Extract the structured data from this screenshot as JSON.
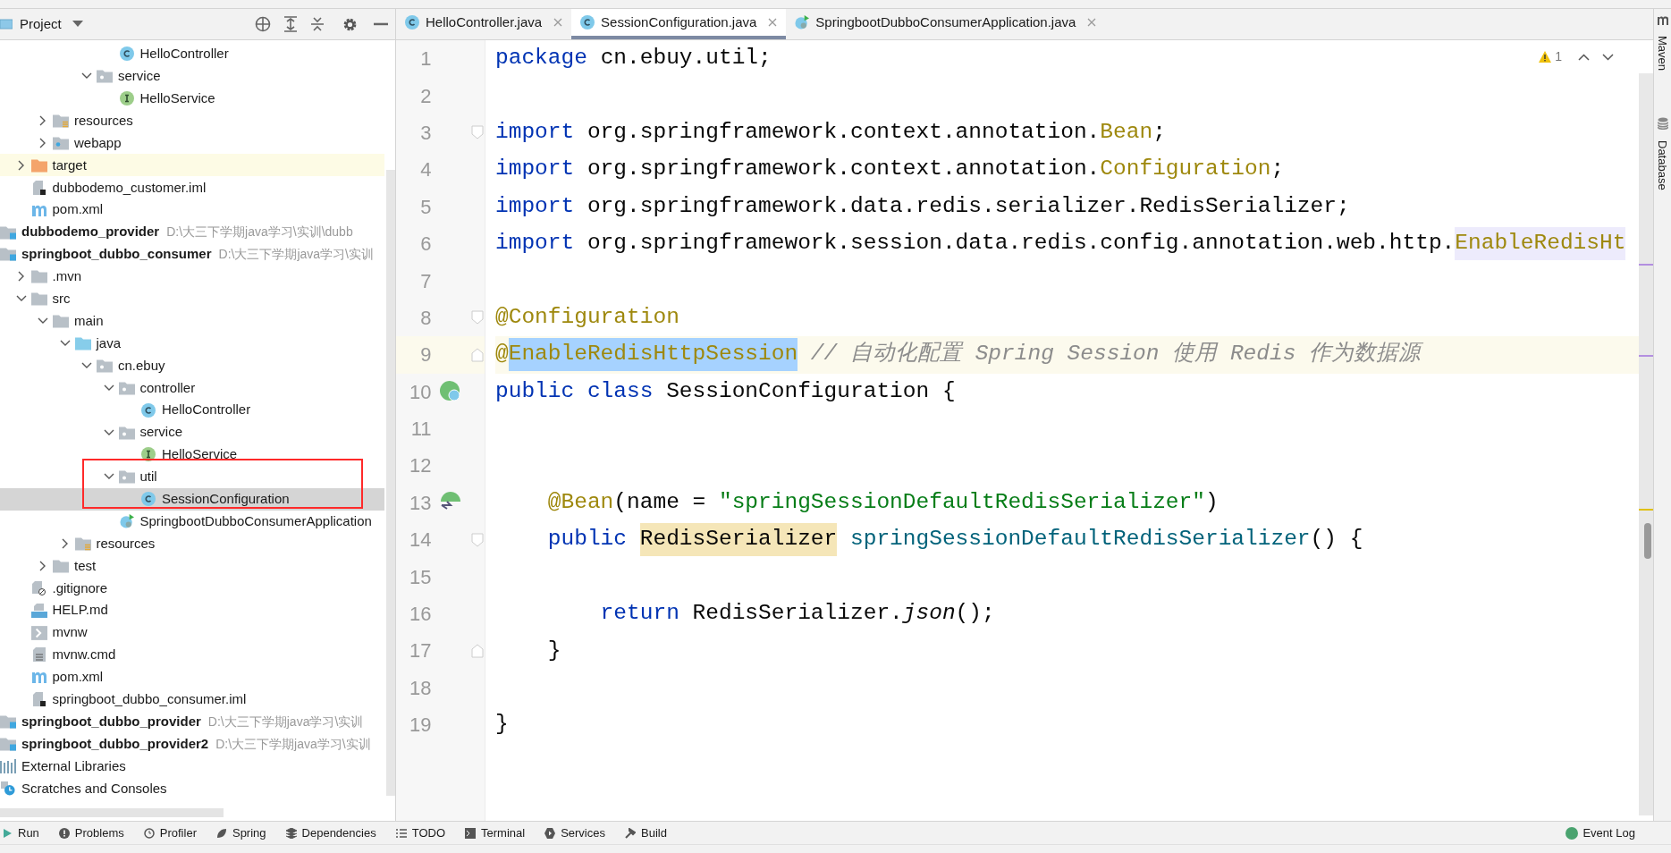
{
  "project_panel": {
    "title": "Project",
    "tree_continued": [
      {
        "children": [
          {
            "children": [
              {
                "children": [
                  {
                    "children": [
                      {
                        "label": "HelloController",
                        "kind": "class"
                      }
                    ]
                  },
                  {
                    "label": "service",
                    "kind": "package",
                    "expanded": true,
                    "children": [
                      {
                        "label": "HelloService",
                        "kind": "interface"
                      }
                    ]
                  }
                ]
              }
            ]
          },
          {
            "label": "resources",
            "kind": "resources",
            "expanded": false
          },
          {
            "label": "webapp",
            "kind": "webapp",
            "expanded": false
          }
        ]
      },
      {
        "label": "target",
        "kind": "excluded",
        "expanded": false,
        "excluded": true
      },
      {
        "label": "dubbodemo_customer.iml",
        "kind": "iml"
      },
      {
        "label": "pom.xml",
        "kind": "maven"
      }
    ],
    "tree": [
      {
        "label": "dubbodemo_provider",
        "path": "D:\\大三下学期java学习\\实训\\dubb",
        "kind": "module"
      },
      {
        "label": "springboot_dubbo_consumer",
        "path": "D:\\大三下学期java学习\\实训",
        "kind": "module",
        "children": [
          {
            "label": ".mvn",
            "kind": "folder",
            "expanded": false
          },
          {
            "label": "src",
            "kind": "folder",
            "expanded": true,
            "children": [
              {
                "label": "main",
                "kind": "folder",
                "expanded": true,
                "children": [
                  {
                    "label": "java",
                    "kind": "source",
                    "expanded": true,
                    "children": [
                      {
                        "label": "cn.ebuy",
                        "kind": "package",
                        "expanded": true,
                        "children": [
                          {
                            "label": "controller",
                            "kind": "package",
                            "expanded": true,
                            "children": [
                              {
                                "label": "HelloController",
                                "kind": "class"
                              }
                            ]
                          },
                          {
                            "label": "service",
                            "kind": "package",
                            "expanded": true,
                            "children": [
                              {
                                "label": "HelloService",
                                "kind": "interface"
                              }
                            ]
                          },
                          {
                            "label": "util",
                            "kind": "package",
                            "expanded": true,
                            "children": [
                              {
                                "label": "SessionConfiguration",
                                "kind": "class",
                                "selected": true
                              }
                            ]
                          },
                          {
                            "label": "SpringbootDubboConsumerApplication",
                            "kind": "spring-app"
                          }
                        ]
                      }
                    ]
                  },
                  {
                    "label": "resources",
                    "kind": "resources",
                    "expanded": false
                  }
                ]
              },
              {
                "label": "test",
                "kind": "folder",
                "expanded": false
              }
            ]
          },
          {
            "label": ".gitignore",
            "kind": "ignore"
          },
          {
            "label": "HELP.md",
            "kind": "markdown"
          },
          {
            "label": "mvnw",
            "kind": "script"
          },
          {
            "label": "mvnw.cmd",
            "kind": "text"
          },
          {
            "label": "pom.xml",
            "kind": "maven"
          },
          {
            "label": "springboot_dubbo_consumer.iml",
            "kind": "iml"
          }
        ]
      },
      {
        "label": "springboot_dubbo_provider",
        "path": "D:\\大三下学期java学习\\实训",
        "kind": "module"
      },
      {
        "label": "springboot_dubbo_provider2",
        "path": "D:\\大三下学期java学习\\实训",
        "kind": "module"
      },
      {
        "label": "External Libraries",
        "kind": "libraries"
      },
      {
        "label": "Scratches and Consoles",
        "kind": "scratches"
      }
    ]
  },
  "editor_tabs": [
    {
      "label": "HelloController.java",
      "kind": "class",
      "selected": false
    },
    {
      "label": "SessionConfiguration.java",
      "kind": "class",
      "selected": true
    },
    {
      "label": "SpringbootDubboConsumerApplication.java",
      "kind": "spring-app",
      "selected": false
    }
  ],
  "inspection": {
    "warnings": "1"
  },
  "code_lines": [
    {
      "number": "1",
      "tokens": [
        {
          "text": "package ",
          "kind": "keyword"
        },
        {
          "text": "cn.ebuy.util;",
          "kind": "plain"
        }
      ]
    },
    {
      "number": "2"
    },
    {
      "number": "3",
      "kind": "fold-start",
      "tokens": [
        {
          "text": "import ",
          "kind": "keyword"
        },
        {
          "text": "org.springframework.context.annotation.",
          "kind": "plain"
        },
        {
          "text": "Bean",
          "kind": "annotation"
        },
        {
          "text": ";",
          "kind": "plain"
        }
      ]
    },
    {
      "number": "4",
      "tokens": [
        {
          "text": "import ",
          "kind": "keyword"
        },
        {
          "text": "org.springframework.context.annotation.",
          "kind": "plain"
        },
        {
          "text": "Configuration",
          "kind": "annotation"
        },
        {
          "text": ";",
          "kind": "plain"
        }
      ]
    },
    {
      "number": "5",
      "tokens": [
        {
          "text": "import ",
          "kind": "keyword"
        },
        {
          "text": "org.springframework.data.redis.serializer.RedisSerializer;",
          "kind": "plain"
        }
      ]
    },
    {
      "number": "6",
      "tokens": [
        {
          "text": "import ",
          "kind": "keyword"
        },
        {
          "text": "org.springframework.session.data.redis.config.annotation.web.http.",
          "kind": "plain"
        },
        {
          "text": "EnableRedisHt",
          "kind": "annotation-marked"
        }
      ]
    },
    {
      "number": "7"
    },
    {
      "number": "8",
      "kind": "fold-start",
      "tokens": [
        {
          "text": "@Configuration",
          "kind": "annotation"
        }
      ]
    },
    {
      "number": "9",
      "kind": "fold-end",
      "current": true,
      "tokens": [
        {
          "text": "@",
          "kind": "annotation"
        },
        {
          "text": "EnableRedisHttpSession",
          "kind": "annotation-selected"
        },
        {
          "text": " // 自动化配置 Spring Session 使用 Redis 作为数据源",
          "kind": "comment"
        }
      ]
    },
    {
      "number": "10",
      "kind": "bean-class",
      "tokens": [
        {
          "text": "public class ",
          "kind": "keyword"
        },
        {
          "text": "SessionConfiguration {",
          "kind": "plain"
        }
      ]
    },
    {
      "number": "11"
    },
    {
      "number": "12"
    },
    {
      "number": "13",
      "kind": "bean-method",
      "tokens": [
        {
          "text": "    @Bean",
          "kind": "annotation"
        },
        {
          "text": "(name = ",
          "kind": "plain"
        },
        {
          "text": "\"springSessionDefaultRedisSerializer\"",
          "kind": "string"
        },
        {
          "text": ")",
          "kind": "plain"
        }
      ]
    },
    {
      "number": "14",
      "kind": "fold-start",
      "tokens": [
        {
          "text": "    public ",
          "kind": "keyword"
        },
        {
          "text": "RedisSerializer",
          "kind": "type-highlight"
        },
        {
          "text": " springSessionDefaultRedisSerializer",
          "kind": "method"
        },
        {
          "text": "() {",
          "kind": "plain"
        }
      ]
    },
    {
      "number": "15"
    },
    {
      "number": "16",
      "tokens": [
        {
          "text": "        return ",
          "kind": "keyword"
        },
        {
          "text": "RedisSerializer.",
          "kind": "plain"
        },
        {
          "text": "json",
          "kind": "italic"
        },
        {
          "text": "();",
          "kind": "plain"
        }
      ]
    },
    {
      "number": "17",
      "kind": "fold-end",
      "tokens": [
        {
          "text": "    }",
          "kind": "plain"
        }
      ]
    },
    {
      "number": "18"
    },
    {
      "number": "19",
      "tokens": [
        {
          "text": "}",
          "kind": "plain"
        }
      ]
    }
  ],
  "right_sidebar": [
    {
      "label": "Maven",
      "kind": "maven"
    },
    {
      "label": "Database",
      "kind": "database"
    }
  ],
  "bottom_toolbar": [
    {
      "label": "Run",
      "kind": "run"
    },
    {
      "label": "Problems",
      "kind": "problems"
    },
    {
      "label": "Profiler",
      "kind": "profiler"
    },
    {
      "label": "Spring",
      "kind": "spring"
    },
    {
      "label": "Dependencies",
      "kind": "dependencies"
    },
    {
      "label": "TODO",
      "kind": "todo"
    },
    {
      "label": "Terminal",
      "kind": "terminal"
    },
    {
      "label": "Services",
      "kind": "services"
    },
    {
      "label": "Build",
      "kind": "build"
    }
  ],
  "event_log": {
    "label": "Event Log"
  }
}
